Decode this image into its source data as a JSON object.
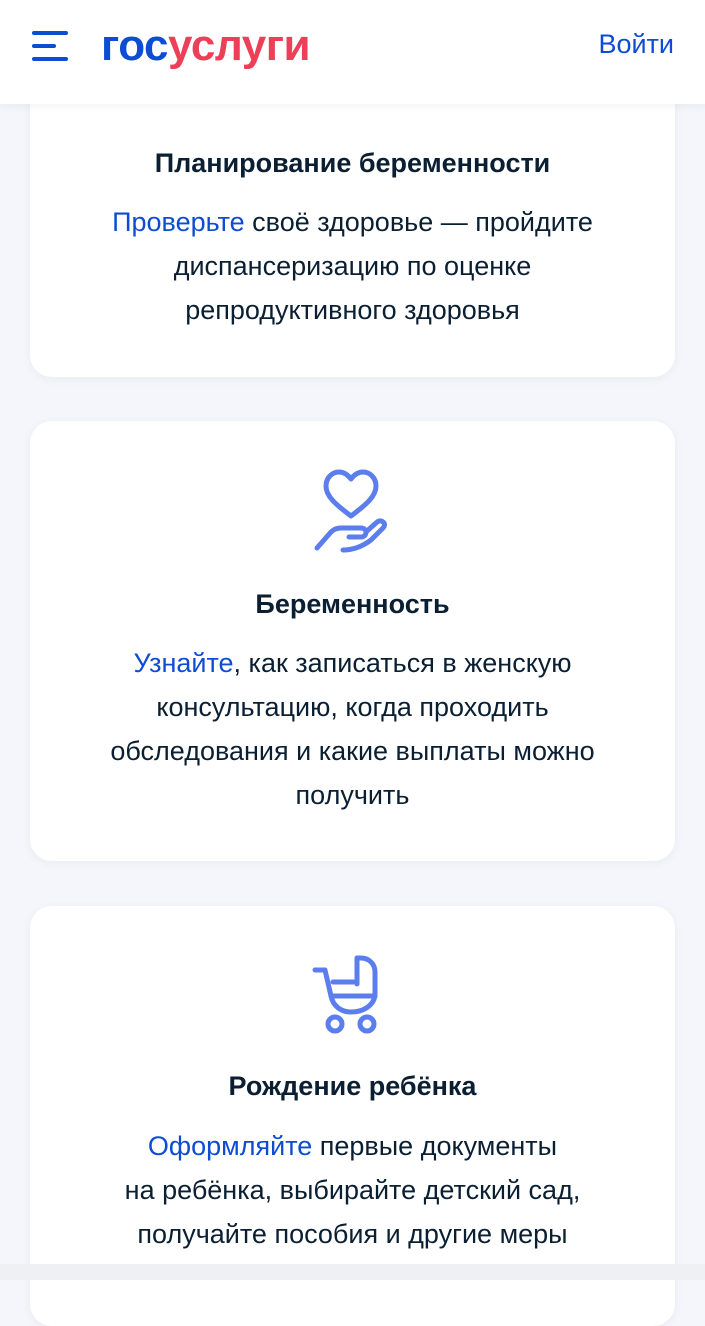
{
  "header": {
    "logo_part1": "гос",
    "logo_part2": "услуги",
    "login_label": "Войти",
    "menu_icon": "menu-icon"
  },
  "colors": {
    "brand_blue": "#0d4cd3",
    "brand_red": "#ee3f58",
    "icon_blue": "#5b7ded",
    "text_dark": "#0b1f33",
    "background": "#f4f6fb"
  },
  "cards": [
    {
      "title": "Планирование беременности",
      "link_text": "Проверьте",
      "text_line1_rest": " своё здоровье — пройдите",
      "text_line2": "диспансеризацию по оценке",
      "text_line3": "репродуктивного здоровья"
    },
    {
      "icon": "hand-heart-icon",
      "title": "Беременность",
      "link_text": "Узнайте",
      "text_line1_rest": ", как записаться в женскую",
      "text_line2": "консультацию, когда проходить",
      "text_line3": "обследования и какие выплаты можно",
      "text_line4": "получить"
    },
    {
      "icon": "baby-stroller-icon",
      "title": "Рождение ребёнка",
      "link_text": "Оформляйте",
      "text_line1_rest": " первые документы",
      "text_line2": "на ребёнка, выбирайте детский сад,",
      "text_line3": "получайте пособия и другие меры"
    }
  ]
}
